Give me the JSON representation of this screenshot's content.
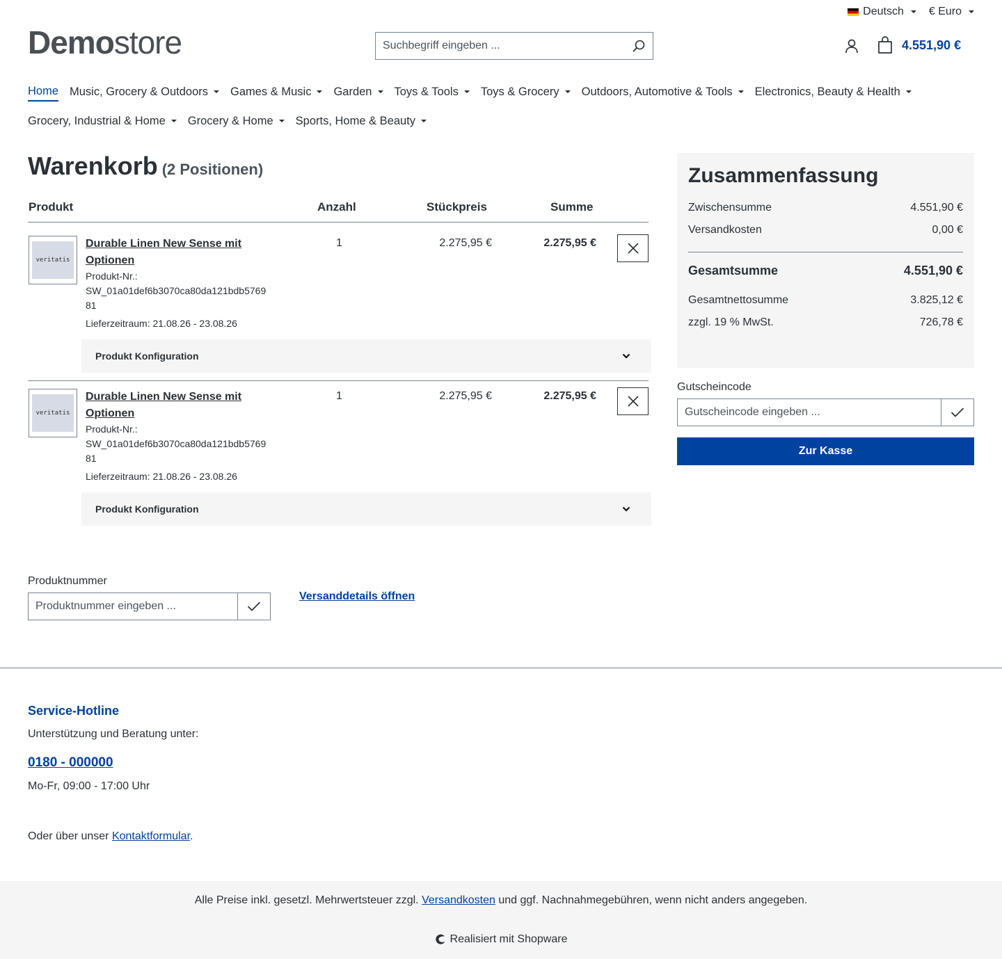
{
  "topbar": {
    "language": "Deutsch",
    "currency": "€ Euro"
  },
  "logo": {
    "bold": "Demo",
    "light": "store"
  },
  "search": {
    "placeholder": "Suchbegriff eingeben ..."
  },
  "cart_total": "4.551,90 €",
  "nav": [
    "Home",
    "Music, Grocery & Outdoors",
    "Games & Music",
    "Garden",
    "Toys & Tools",
    "Toys & Grocery",
    "Outdoors, Automotive & Tools",
    "Electronics, Beauty & Health",
    "Grocery, Industrial & Home",
    "Grocery & Home",
    "Sports, Home & Beauty"
  ],
  "cart": {
    "title": "Warenkorb",
    "count": "(2 Positionen)",
    "headers": {
      "product": "Produkt",
      "qty": "Anzahl",
      "unit": "Stückpreis",
      "sum": "Summe"
    },
    "items": [
      {
        "thumb": "veritatis",
        "name": "Durable Linen New Sense mit Optionen",
        "number_label": "Produkt-Nr.:",
        "number": "SW_01a01def6b3070ca80da121bdb576981",
        "delivery": "Lieferzeitraum: 21.08.26 - 23.08.26",
        "qty": "1",
        "price": "2.275,95 €",
        "sum": "2.275,95 €",
        "config": "Produkt Konfiguration"
      },
      {
        "thumb": "veritatis",
        "name": "Durable Linen New Sense mit Optionen",
        "number_label": "Produkt-Nr.:",
        "number": "SW_01a01def6b3070ca80da121bdb576981",
        "delivery": "Lieferzeitraum: 21.08.26 - 23.08.26",
        "qty": "1",
        "price": "2.275,95 €",
        "sum": "2.275,95 €",
        "config": "Produkt Konfiguration"
      }
    ]
  },
  "summary": {
    "title": "Zusammenfassung",
    "subtotal_label": "Zwischensumme",
    "subtotal": "4.551,90 €",
    "shipping_label": "Versandkosten",
    "shipping": "0,00 €",
    "total_label": "Gesamtsumme",
    "total": "4.551,90 €",
    "net_label": "Gesamtnettosumme",
    "net": "3.825,12 €",
    "tax_label": "zzgl. 19 % MwSt.",
    "tax": "726,78 €"
  },
  "voucher": {
    "label": "Gutscheincode",
    "placeholder": "Gutscheincode eingeben ..."
  },
  "checkout_label": "Zur Kasse",
  "product_number": {
    "label": "Produktnummer",
    "placeholder": "Produktnummer eingeben ..."
  },
  "shipping_details_link": "Versanddetails öffnen",
  "footer": {
    "hotline_title": "Service-Hotline",
    "hotline_sub": "Unterstützung und Beratung unter:",
    "phone": "0180 - 000000",
    "hours": "Mo-Fr, 09:00 - 17:00 Uhr",
    "contact_prefix": "Oder über unser ",
    "contact_link": "Kontaktformular",
    "contact_suffix": ".",
    "vat_prefix": "Alle Preise inkl. gesetzl. Mehrwertsteuer zzgl. ",
    "vat_link": "Versandkosten",
    "vat_suffix": " und ggf. Nachnahmegebühren, wenn nicht anders angegeben.",
    "powered": "Realisiert mit Shopware"
  },
  "colors": {
    "primary": "#0042a0",
    "text": "#2b3136",
    "panel": "#f5f5f5"
  }
}
